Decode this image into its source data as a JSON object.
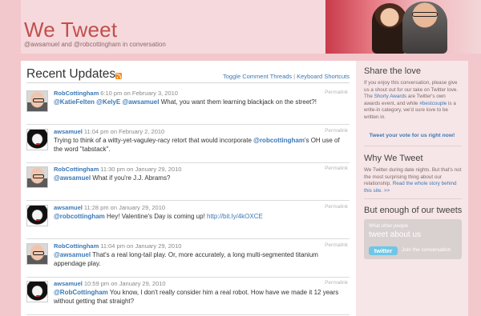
{
  "header": {
    "title": "We Tweet",
    "subtitle": "@awsamuel and @robcottingham in conversation"
  },
  "main": {
    "title": "Recent Updates",
    "rss_icon": "rss-icon",
    "links": {
      "toggle": "Toggle Comment Threads",
      "separator": "|",
      "shortcuts": "Keyboard Shortcuts"
    },
    "permalink_label": "Permalink",
    "tweets": [
      {
        "author": "RobCottingham",
        "avatar": "rob",
        "meta": "6:10 pm on February 3, 2010",
        "parts": [
          {
            "t": "@KatieFelten",
            "m": true
          },
          {
            "t": " ",
            "m": false
          },
          {
            "t": "@KelyE",
            "m": true
          },
          {
            "t": " ",
            "m": false
          },
          {
            "t": "@awsamuel",
            "m": "bold"
          },
          {
            "t": " What, you want them learning blackjack on the street?!",
            "m": false
          }
        ]
      },
      {
        "author": "awsamuel",
        "avatar": "aws",
        "meta": "11:04 pm on February 2, 2010",
        "parts": [
          {
            "t": "Trying to think of a witty-yet-vaguley-racy retort that would incorporate ",
            "m": false
          },
          {
            "t": "@robcottingham",
            "m": "bold"
          },
          {
            "t": "'s OH use of the word \"tabstack\".",
            "m": false
          }
        ]
      },
      {
        "author": "RobCottingham",
        "avatar": "rob",
        "meta": "11:30 pm on January 29, 2010",
        "parts": [
          {
            "t": "@awsamuel",
            "m": "bold"
          },
          {
            "t": " What if you're J.J. Abrams?",
            "m": false
          }
        ]
      },
      {
        "author": "awsamuel",
        "avatar": "aws",
        "meta": "11:28 pm on January 29, 2010",
        "parts": [
          {
            "t": "@robcottingham",
            "m": "bold"
          },
          {
            "t": " Hey! Valentine's Day is coming up! ",
            "m": false
          },
          {
            "t": "http://bit.ly/4kOXCE",
            "m": "link"
          }
        ]
      },
      {
        "author": "RobCottingham",
        "avatar": "rob",
        "meta": "11:04 pm on January 29, 2010",
        "parts": [
          {
            "t": "@awsamuel",
            "m": "bold"
          },
          {
            "t": " That's a real long-tail play. Or, more accurately, a long multi-segmented titanium appendage play.",
            "m": false
          }
        ]
      },
      {
        "author": "awsamuel",
        "avatar": "aws",
        "meta": "10:59 pm on January 29, 2010",
        "parts": [
          {
            "t": "@RobCottingham",
            "m": "bold"
          },
          {
            "t": " You know, I don't really consider him a real robot. How have we made it 12 years without getting that straight?",
            "m": false
          }
        ]
      }
    ]
  },
  "sidebar": {
    "share": {
      "heading": "Share the love",
      "text_1": "If you enjoy this conversation, please give us a shout out for our take on Twitter love. The ",
      "link_1": "Shorty Awards",
      "text_2": " are Twitter's own awards event, and while ",
      "link_2": "#bestcouple",
      "text_3": " is a write-in category, we'd sure love to be written in.",
      "cta": "Tweet your vote for us right now!"
    },
    "why": {
      "heading": "Why We Tweet",
      "text": "We Twitter during date nights. But that's not the most surprising thing about our relationship. ",
      "link": "Read the whole story behind this site. >>"
    },
    "enough": {
      "heading": "But enough of our tweets",
      "box_small": "What other people",
      "box_big": "tweet about us",
      "logo": "twitter",
      "join": "Join the conversation"
    }
  },
  "colors": {
    "background": "#f2c8cc",
    "title": "#c0504d",
    "link": "#3a78b6"
  }
}
